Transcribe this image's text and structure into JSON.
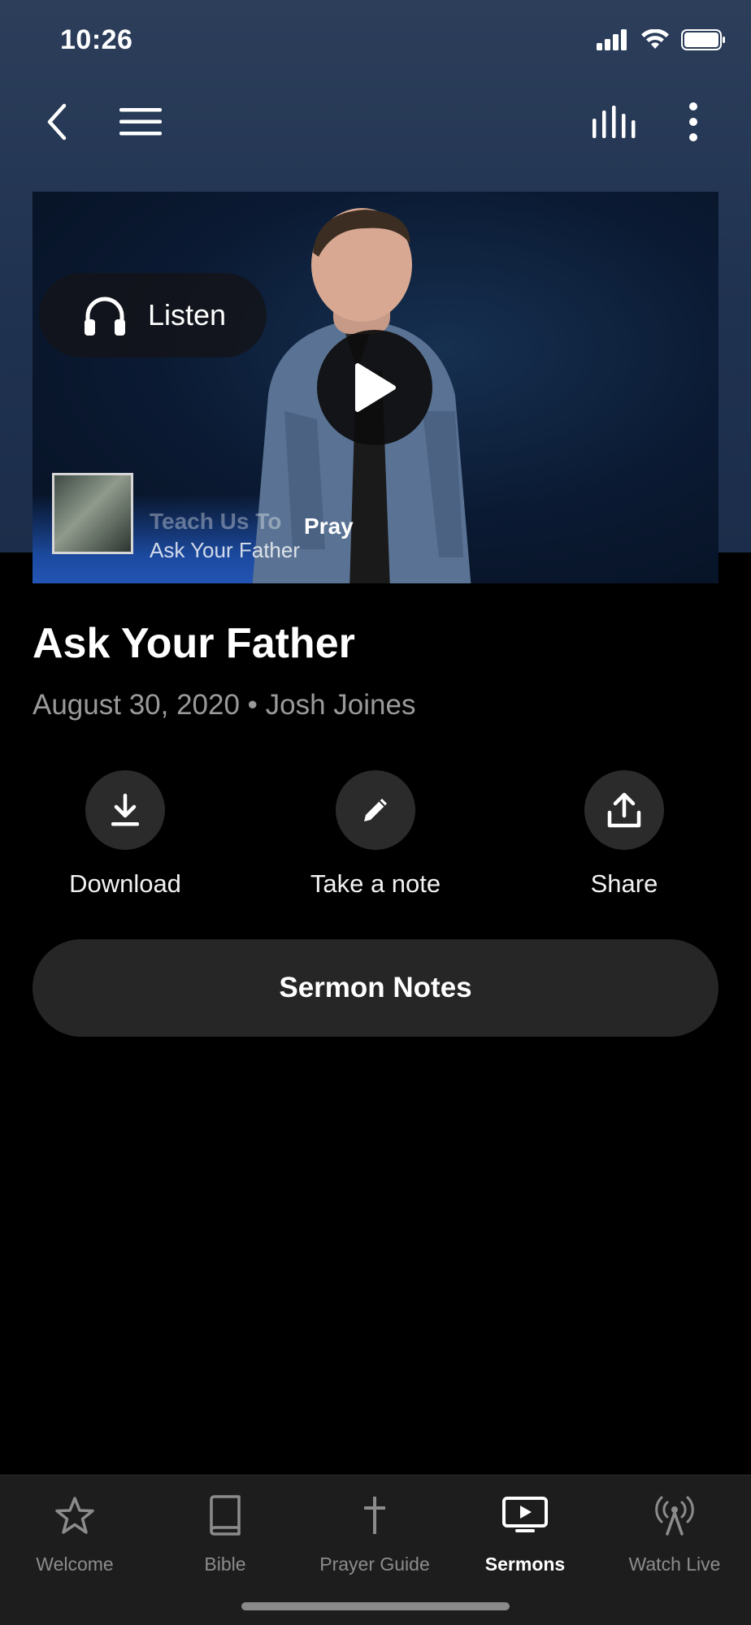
{
  "status_bar": {
    "time": "10:26"
  },
  "colors": {
    "background": "#000000",
    "header": "#1f3250",
    "pill": "#262626",
    "muted_text": "#9a9a9a",
    "tab_inactive": "#8c8c8c",
    "tab_active": "#ffffff"
  },
  "nav": {
    "icons": [
      "back-chevron-icon",
      "hamburger-menu-icon",
      "audio-levels-icon",
      "more-vertical-icon"
    ]
  },
  "hero": {
    "overlay_title": "Teach Us To",
    "overlay_pray": "Pray",
    "overlay_subtitle": "Ask Your Father",
    "listen_label": "Listen"
  },
  "sermon": {
    "title": "Ask Your Father",
    "meta": "August 30, 2020 • Josh Joines"
  },
  "actions": [
    {
      "label": "Download",
      "icon": "download-icon"
    },
    {
      "label": "Take a note",
      "icon": "pencil-icon"
    },
    {
      "label": "Share",
      "icon": "share-icon"
    }
  ],
  "sermon_notes_label": "Sermon Notes",
  "tabs": [
    {
      "label": "Welcome",
      "icon": "star-icon",
      "active": false
    },
    {
      "label": "Bible",
      "icon": "book-icon",
      "active": false
    },
    {
      "label": "Prayer Guide",
      "icon": "cross-icon",
      "active": false
    },
    {
      "label": "Sermons",
      "icon": "tv-play-icon",
      "active": true
    },
    {
      "label": "Watch Live",
      "icon": "broadcast-icon",
      "active": false
    }
  ]
}
